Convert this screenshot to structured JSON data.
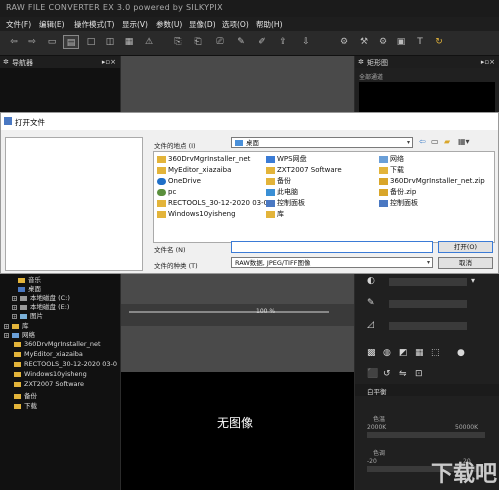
{
  "app": {
    "title": "RAW FILE CONVERTER EX 3.0 powered by SILKYPIX"
  },
  "menu": [
    "文件(F)",
    "编辑(E)",
    "操作模式(T)",
    "显示(V)",
    "参数(U)",
    "显像(D)",
    "选项(O)",
    "帮助(H)"
  ],
  "left_panel": {
    "title": "导航器",
    "tree": [
      "音乐",
      "桌面",
      "本地磁盘 (C:)",
      "本地磁盘 (E:)",
      "图片",
      "库",
      "网络",
      "360DrvMgrInstaller_net",
      "MyEditor_xiazaiba",
      "RECTOOLS_30-12-2020 03-0",
      "Windows10yisheng",
      "ZXT2007 Software",
      "备份",
      "下载"
    ]
  },
  "right_panel": {
    "title": "矩形图",
    "subtitle": "全部通道",
    "white_balance": "白平衡",
    "color_temp": "色温",
    "temp_min": "2000K",
    "temp_max": "50000K",
    "tint": "色调",
    "tint_min": "-20",
    "tint_max": "20"
  },
  "center": {
    "no_image": "无图像",
    "zoom": "100 %"
  },
  "dialog": {
    "title": "打开文件",
    "lookin_label": "文件的地点 (I)",
    "lookin_value": "桌面",
    "items_col1": [
      "360DrvMgrInstaller_net",
      "MyEditor_xiazaiba",
      "OneDrive",
      "pc",
      "RECTOOLS_30-12-2020 03-00",
      "Windows10yisheng"
    ],
    "items_col2": [
      "WPS网盘",
      "ZXT2007 Software",
      "备份",
      "此电脑",
      "控制面板",
      "库"
    ],
    "items_col3": [
      "网络",
      "下载",
      "360DrvMgrInstaller_net.zip",
      "备份.zip",
      "控制面板"
    ],
    "filename_label": "文件名 (N)",
    "filename_value": "",
    "filetype_label": "文件的种类 (T)",
    "filetype_value": "RAW数据, JPEG/TIFF图像",
    "open_button": "打开(O)",
    "cancel_button": "取消"
  },
  "watermark": "下载吧",
  "colors": {
    "accent": "#e3b43a",
    "folder": "#e3b43a",
    "dialog_bg": "#f0f0f0",
    "panel_dark": "#111111"
  }
}
